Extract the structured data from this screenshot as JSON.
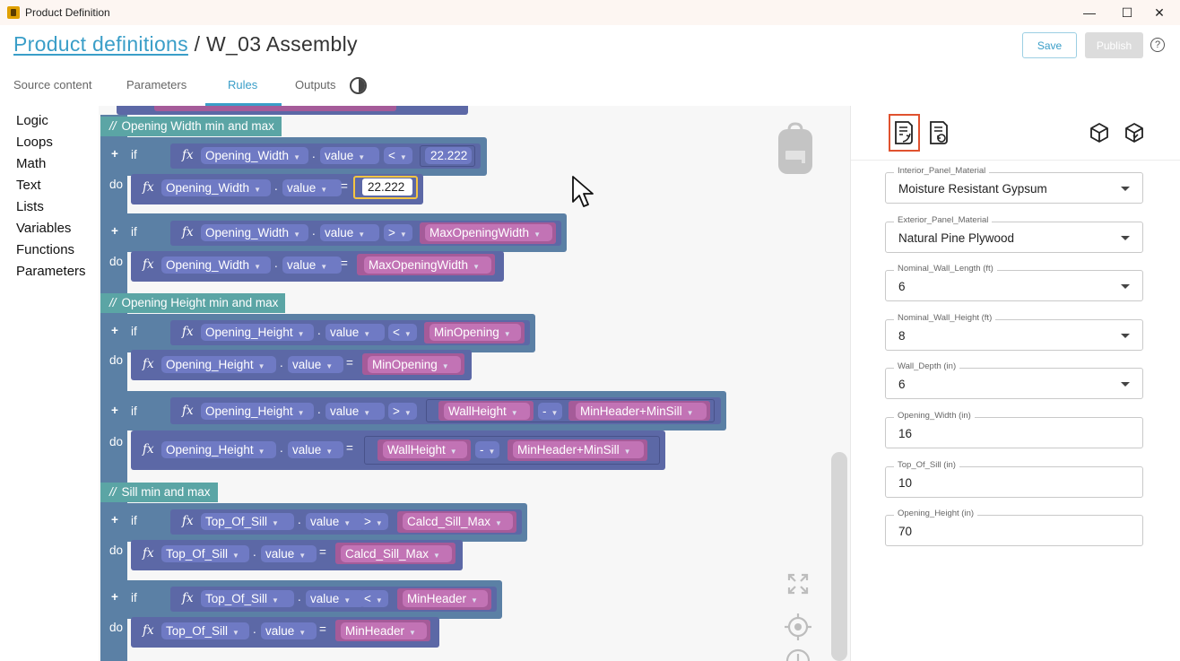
{
  "window": {
    "title": "Product Definition",
    "minimize": "—",
    "maximize": "☐",
    "close": "✕"
  },
  "header": {
    "breadcrumb_link": "Product definitions",
    "separator": " / ",
    "current": "W_03 Assembly",
    "save_label": "Save",
    "publish_label": "Publish",
    "help": "?"
  },
  "tabs": [
    {
      "label": "Source content"
    },
    {
      "label": "Parameters"
    },
    {
      "label": "Rules",
      "active": true
    },
    {
      "label": "Outputs"
    }
  ],
  "toolbox": [
    "Logic",
    "Loops",
    "Math",
    "Text",
    "Lists",
    "Variables",
    "Functions",
    "Parameters"
  ],
  "panel_icons": [
    "run-rules-icon",
    "reset-rules-icon",
    "model-icon",
    "model-update-icon"
  ],
  "fields": [
    {
      "label": "Interior_Panel_Material",
      "value": "Moisture Resistant Gypsum",
      "dropdown": true
    },
    {
      "label": "Exterior_Panel_Material",
      "value": "Natural Pine Plywood",
      "dropdown": true
    },
    {
      "label": "Nominal_Wall_Length (ft)",
      "value": "6",
      "dropdown": true
    },
    {
      "label": "Nominal_Wall_Height (ft)",
      "value": "8",
      "dropdown": true
    },
    {
      "label": "Wall_Depth (in)",
      "value": "6",
      "dropdown": true
    },
    {
      "label": "Opening_Width (in)",
      "value": "16",
      "dropdown": false
    },
    {
      "label": "Top_Of_Sill (in)",
      "value": "10",
      "dropdown": false
    },
    {
      "label": "Opening_Height (in)",
      "value": "70",
      "dropdown": false
    }
  ],
  "kw": {
    "if": "if",
    "do": "do",
    "plus": "+",
    "fx": "fx",
    "dot": ".",
    "eq": "=",
    "lt": "<",
    "gt": ">",
    "minus": "-",
    "slash": "//"
  },
  "rules": [
    {
      "comment": "Opening Width min and max"
    },
    {
      "param": "Opening_Width",
      "prop": "value",
      "op": "<",
      "rhs": "22.222",
      "do_rhs": "22.222"
    },
    {
      "param": "Opening_Width",
      "prop": "value",
      "op": ">",
      "rhs": "MaxOpeningWidth",
      "do_rhs": "MaxOpeningWidth"
    },
    {
      "comment": "Opening Height min and max"
    },
    {
      "param": "Opening_Height",
      "prop": "value",
      "op": "<",
      "rhs": "MinOpening",
      "do_rhs": "MinOpening"
    },
    {
      "param": "Opening_Height",
      "prop": "value",
      "op": ">",
      "rhs_a": "WallHeight",
      "rhs_op": "-",
      "rhs_b": "MinHeader+MinSill"
    },
    {
      "comment": "Sill min and max"
    },
    {
      "param": "Top_Of_Sill",
      "prop": "value",
      "op": ">",
      "rhs": "Calcd_Sill_Max",
      "do_rhs": "Calcd_Sill_Max"
    },
    {
      "param": "Top_Of_Sill",
      "prop": "value",
      "op": "<",
      "rhs": "MinHeader",
      "do_rhs": "MinHeader"
    }
  ],
  "colors": {
    "accent": "#3a9ec8",
    "logic": "#5b80a5",
    "function": "#5c68a6",
    "variable": "#a55b99",
    "comment": "#5ba5a5",
    "highlight": "#e0522f"
  }
}
